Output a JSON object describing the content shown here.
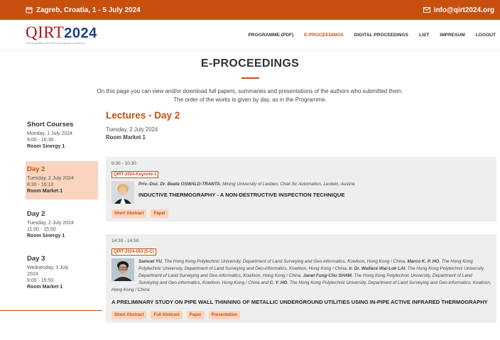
{
  "topbar": {
    "location": "Zagreb, Croatia, 1 - 5 July 2024",
    "email": "info@qirt2024.org",
    "calendar_icon": "calendar-icon",
    "mail_icon": "envelope-icon",
    "color": "#c8500f"
  },
  "logo": {
    "prefix": "QIRT",
    "year": "2024",
    "tagline": "17th Quantitative InfraRed Thermography Conference"
  },
  "menu": {
    "items": [
      "PROGRAMME (PDF)",
      "E-PROCEEDINGS",
      "DIGITAL PROCEEDINGS",
      "LIST",
      "IMPRESUM",
      "LOGOUT"
    ],
    "active": "E-PROCEEDINGS"
  },
  "hero": {
    "title": "E-PROCEEDINGS",
    "line1": "On this page you can view and/or download full papers, summaries and presentations of the authors who submitted them.",
    "line2": "The order of the works is given by day, as in the Programme."
  },
  "sidebar": {
    "items": [
      {
        "title": "Short Courses",
        "lines": [
          "Monday, 1 July 2024",
          "9:00 - 16:30"
        ],
        "room": "Room Sinergy 1",
        "active": false
      },
      {
        "title": "Day 2",
        "lines": [
          "Tuesday, 2 July 2024",
          "8:30 - 16:10"
        ],
        "room": "Room Market 1",
        "active": true
      },
      {
        "title": "Day 2",
        "lines": [
          "Tuesday, 2 July 2024",
          "11:00 - 15:50"
        ],
        "room": "Room Sinergy 1",
        "active": false
      },
      {
        "title": "Day 3",
        "lines": [
          "Wednesday, 3 July",
          "2024",
          "9:00 - 15:50"
        ],
        "room": "Room Market 1",
        "active": false
      }
    ]
  },
  "main": {
    "heading": "Lectures - Day 2",
    "date": "Tuesday, 2 July 2024",
    "room": "Room Market 1"
  },
  "cards": [
    {
      "time": "9:30 - 10:30",
      "code": "QIRT-2024-Keynote-1",
      "authors_html": "<b>Priv.-Doz. Dr. Beate OSWALD-TRANTA</b>, Mining University of Leoben, Chair for Automation, Leoben, Austria",
      "title": "INDUCTIVE THERMOGRAPHY - A NON-DESTRUCTIVE INSPECTION TECHNIQUE",
      "buttons": [
        "Short Abstract",
        "Paper"
      ]
    },
    {
      "time": "14:30 - 14:50",
      "code": "QIRT-2024-053 (5-C)",
      "authors_html": "<b>Samuel YU</b>, The Hong Kong Polytechnic University, Department of Land Surveying and Geo-informatics, Kowloon, Hong Kong / China, <b>Marco K. P. HO</b>, The Hong Kong Polytechnic University, Department of Land Surveying and Geo-informatics, Kowloon, Hong Kong / China, <b>Ir. Dr. Wallace Wai-Lok LAI</b>, The Hong Kong Polytechnic University, Department of Land Surveying and Geo-informatics, Kowloon, Hong Kong / China, <b>Janet Fung-Chu SHAM</b>, The Hong Kong Polytechnic University, Department of Land Surveying and Geo-informatics, Kowloon, Hong Kong / China and <b>C. Y. HO</b>, The Hong Kong Polytechnic University, Department of Land Surveying and Geo-informatics, Kowloon, Hong Kong / China",
      "title": "A PRELIMINARY STUDY ON PIPE WALL THINNING OF METALLIC UNDERGROUND UTILITIES USING IN-PIPE ACTIVE INFRARED THERMOGRAPHY",
      "buttons": [
        "Short Abstract",
        "Full Abstract",
        "Paper",
        "Presentation"
      ]
    }
  ]
}
